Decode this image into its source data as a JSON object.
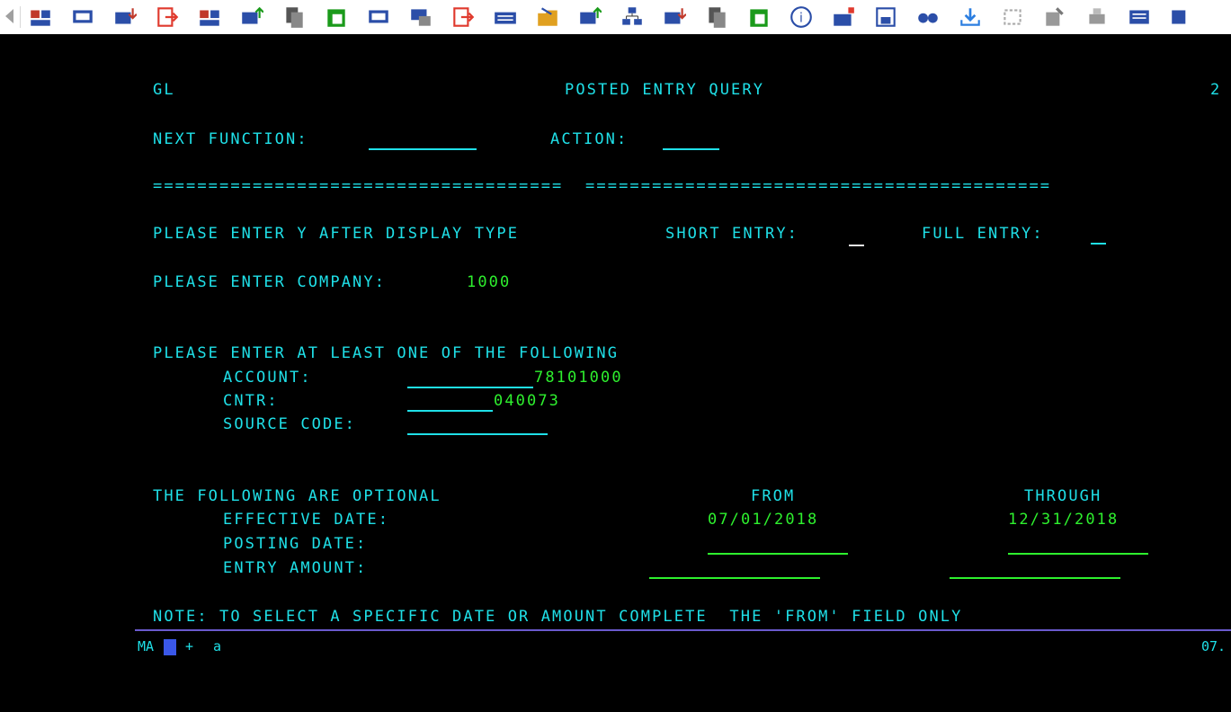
{
  "toolbar": {
    "icons": [
      "back-arrow-icon",
      "transfer-icon",
      "screen-icon",
      "download-icon",
      "exit-icon",
      "transfer-icon",
      "upload-icon",
      "copy-icon",
      "paste-icon",
      "screen-icon",
      "screen-copy-icon",
      "exit-icon",
      "keyboard-icon",
      "folder-icon",
      "upload-icon",
      "network-icon",
      "download-icon",
      "copy-icon",
      "paste-icon",
      "info-icon",
      "macro-icon",
      "save-icon",
      "link-icon",
      "receive-icon",
      "settings-icon",
      "edit-icon",
      "print-icon",
      "keymap-icon",
      "more-icon"
    ]
  },
  "terminal": {
    "system": "GL",
    "title": "POSTED ENTRY QUERY",
    "corner": "2",
    "next_function_label": "NEXT FUNCTION:",
    "action_label": "ACTION:",
    "separator": "=====================================  ==========================================",
    "display_prompt": "PLEASE ENTER Y AFTER DISPLAY TYPE",
    "short_entry_label": "SHORT ENTRY:",
    "full_entry_label": "FULL ENTRY:",
    "company_label": "PLEASE ENTER COMPANY:",
    "company_value": "1000",
    "least_one_label": "PLEASE ENTER AT LEAST ONE OF THE FOLLOWING",
    "account_label": "ACCOUNT:",
    "account_value": "78101000",
    "cntr_label": "CNTR:",
    "cntr_value": "040073",
    "source_code_label": "SOURCE CODE:",
    "optional_label": "THE FOLLOWING ARE OPTIONAL",
    "from_label": "FROM",
    "through_label": "THROUGH",
    "effective_date_label": "EFFECTIVE DATE:",
    "effective_from": "07/01/2018",
    "effective_through": "12/31/2018",
    "posting_date_label": "POSTING DATE:",
    "entry_amount_label": "ENTRY AMOUNT:",
    "note": "NOTE: TO SELECT A SPECIFIC DATE OR AMOUNT COMPLETE  THE 'FROM' FIELD ONLY"
  },
  "oia": {
    "mode": "MA",
    "cursor_char": "A",
    "plus": "+",
    "indicator": "a",
    "right": "07."
  },
  "colors": {
    "background": "#000000",
    "label_text": "#1fe0e8",
    "input_text": "#2ef02e",
    "oia_line": "#6a5acd"
  }
}
